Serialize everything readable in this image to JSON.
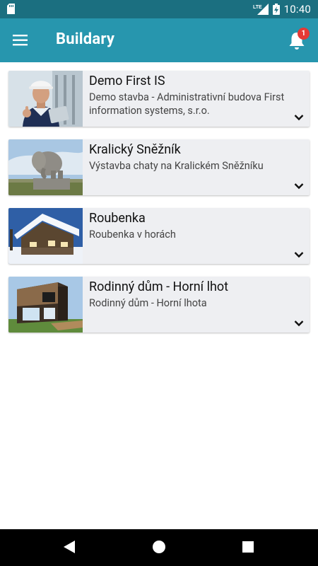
{
  "status_bar": {
    "network": "LTE",
    "time": "10:40"
  },
  "app_bar": {
    "title": "Buildary",
    "notification_count": "1"
  },
  "projects": [
    {
      "name": "Demo First IS",
      "description": "Demo stavba - Administrativní budova First information systems, s.r.o.",
      "image": "engineer-photo"
    },
    {
      "name": "Kralický Sněžník",
      "description": "Výstavba chaty na Kralickém Sněžníku",
      "image": "elephant-statue-photo"
    },
    {
      "name": "Roubenka",
      "description": "Roubenka v horách",
      "image": "log-cabin-photo"
    },
    {
      "name": "Rodinný dům - Horní lhot",
      "description": "Rodinný dům - Horní lhota",
      "image": "modern-house-photo"
    }
  ],
  "colors": {
    "status_bar": "#1b6f80",
    "app_bar": "#2796ae",
    "card": "#eeeff2",
    "badge": "#e53935"
  }
}
